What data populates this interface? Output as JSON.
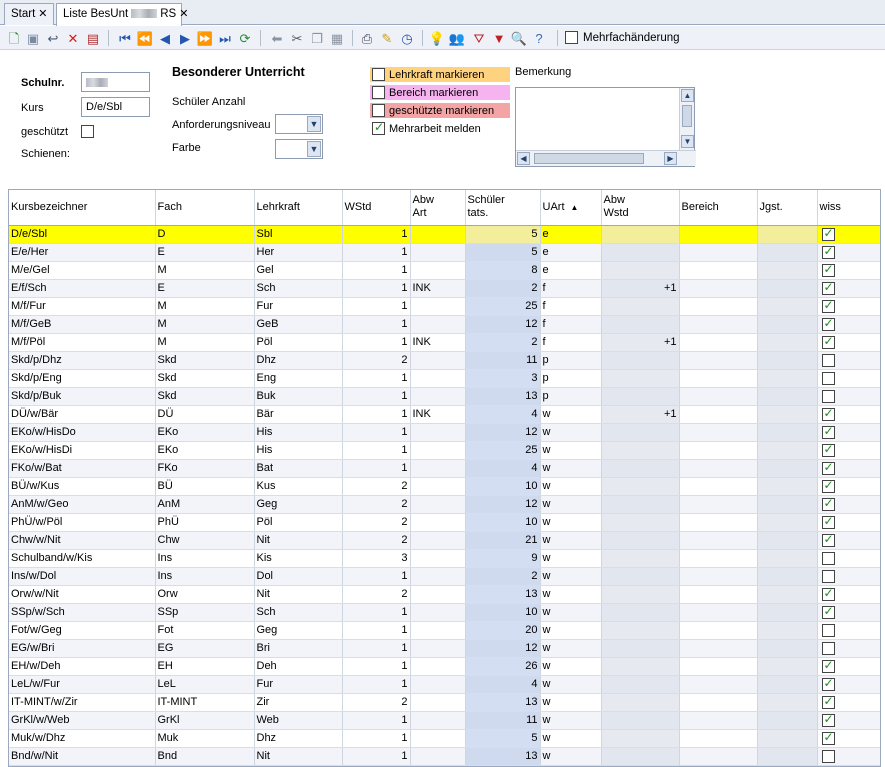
{
  "tabs": [
    {
      "label": "Start",
      "close": "✕"
    },
    {
      "label_before": "Liste BesUnt",
      "label_after": "RS",
      "close": "✕"
    }
  ],
  "toolbar": {
    "icons": [
      "new-icon",
      "save-icon",
      "undo-icon",
      "delete-icon",
      "properties-icon",
      "first-icon",
      "prev-page-icon",
      "prev-icon",
      "next-icon",
      "next-page-icon",
      "last-icon",
      "refresh-icon",
      "back-arrow-icon",
      "cut-icon",
      "copy-icon",
      "paste-icon",
      "print-icon",
      "broom-icon",
      "clock-icon",
      "bulb-icon",
      "users-icon",
      "filter-delete-icon",
      "filter-icon",
      "user-search-icon",
      "help-icon"
    ],
    "mehrfach_label": "Mehrfachänderung",
    "mehrfach_checked": false
  },
  "form": {
    "schulnr_label": "Schulnr.",
    "kurs_label": "Kurs",
    "kurs_value": "D/e/Sbl",
    "geschuetzt_label": "geschützt",
    "schienen_label": "Schienen:",
    "title": "Besonderer Unterricht",
    "schueler_anzahl_label": "Schüler Anzahl",
    "anforderung_label": "Anforderungsniveau",
    "farbe_label": "Farbe",
    "highlight_teacher": "Lehrkraft markieren",
    "highlight_area": "Bereich markieren",
    "highlight_protected": "geschützte markieren",
    "mehrarbeit_label": "Mehrarbeit melden",
    "mehrarbeit_checked": true,
    "bemerkung_label": "Bemerkung",
    "colors": {
      "teacher": "#ffd27f",
      "area": "#f7b3f0",
      "protected": "#f4a4a4"
    }
  },
  "grid": {
    "headers": [
      "Kursbezeichner",
      "Fach",
      "Lehrkraft",
      "WStd",
      "Abw\nArt",
      "Schüler\ntats.",
      "UArt",
      "Abw\nWstd",
      "Bereich",
      "Jgst.",
      "wiss"
    ],
    "rows": [
      [
        "D/e/Sbl",
        "D",
        "Sbl",
        "1",
        "",
        "5",
        "e",
        "",
        "",
        "",
        true
      ],
      [
        "E/e/Her",
        "E",
        "Her",
        "1",
        "",
        "5",
        "e",
        "",
        "",
        "",
        true
      ],
      [
        "M/e/Gel",
        "M",
        "Gel",
        "1",
        "",
        "8",
        "e",
        "",
        "",
        "",
        true
      ],
      [
        "E/f/Sch",
        "E",
        "Sch",
        "1",
        "INK",
        "2",
        "f",
        "+1",
        "",
        "",
        true
      ],
      [
        "M/f/Fur",
        "M",
        "Fur",
        "1",
        "",
        "25",
        "f",
        "",
        "",
        "",
        true
      ],
      [
        "M/f/GeB",
        "M",
        "GeB",
        "1",
        "",
        "12",
        "f",
        "",
        "",
        "",
        true
      ],
      [
        "M/f/Pöl",
        "M",
        "Pöl",
        "1",
        "INK",
        "2",
        "f",
        "+1",
        "",
        "",
        true
      ],
      [
        "Skd/p/Dhz",
        "Skd",
        "Dhz",
        "2",
        "",
        "11",
        "p",
        "",
        "",
        "",
        false
      ],
      [
        "Skd/p/Eng",
        "Skd",
        "Eng",
        "1",
        "",
        "3",
        "p",
        "",
        "",
        "",
        false
      ],
      [
        "Skd/p/Buk",
        "Skd",
        "Buk",
        "1",
        "",
        "13",
        "p",
        "",
        "",
        "",
        false
      ],
      [
        "DÜ/w/Bär",
        "DÜ",
        "Bär",
        "1",
        "INK",
        "4",
        "w",
        "+1",
        "",
        "",
        true
      ],
      [
        "EKo/w/HisDo",
        "EKo",
        "His",
        "1",
        "",
        "12",
        "w",
        "",
        "",
        "",
        true
      ],
      [
        "EKo/w/HisDi",
        "EKo",
        "His",
        "1",
        "",
        "25",
        "w",
        "",
        "",
        "",
        true
      ],
      [
        "FKo/w/Bat",
        "FKo",
        "Bat",
        "1",
        "",
        "4",
        "w",
        "",
        "",
        "",
        true
      ],
      [
        "BÜ/w/Kus",
        "BÜ",
        "Kus",
        "2",
        "",
        "10",
        "w",
        "",
        "",
        "",
        true
      ],
      [
        "AnM/w/Geo",
        "AnM",
        "Geg",
        "2",
        "",
        "12",
        "w",
        "",
        "",
        "",
        true
      ],
      [
        "PhÜ/w/Pöl",
        "PhÜ",
        "Pöl",
        "2",
        "",
        "10",
        "w",
        "",
        "",
        "",
        true
      ],
      [
        "Chw/w/Nit",
        "Chw",
        "Nit",
        "2",
        "",
        "21",
        "w",
        "",
        "",
        "",
        true
      ],
      [
        "Schulband/w/Kis",
        "Ins",
        "Kis",
        "3",
        "",
        "9",
        "w",
        "",
        "",
        "",
        false
      ],
      [
        "Ins/w/Dol",
        "Ins",
        "Dol",
        "1",
        "",
        "2",
        "w",
        "",
        "",
        "",
        false
      ],
      [
        "Orw/w/Nit",
        "Orw",
        "Nit",
        "2",
        "",
        "13",
        "w",
        "",
        "",
        "",
        true
      ],
      [
        "SSp/w/Sch",
        "SSp",
        "Sch",
        "1",
        "",
        "10",
        "w",
        "",
        "",
        "",
        true
      ],
      [
        "Fot/w/Geg",
        "Fot",
        "Geg",
        "1",
        "",
        "20",
        "w",
        "",
        "",
        "",
        false
      ],
      [
        "EG/w/Bri",
        "EG",
        "Bri",
        "1",
        "",
        "12",
        "w",
        "",
        "",
        "",
        false
      ],
      [
        "EH/w/Deh",
        "EH",
        "Deh",
        "1",
        "",
        "26",
        "w",
        "",
        "",
        "",
        true
      ],
      [
        "LeL/w/Fur",
        "LeL",
        "Fur",
        "1",
        "",
        "4",
        "w",
        "",
        "",
        "",
        true
      ],
      [
        "IT-MINT/w/Zir",
        "IT-MINT",
        "Zir",
        "2",
        "",
        "13",
        "w",
        "",
        "",
        "",
        true
      ],
      [
        "GrKl/w/Web",
        "GrKl",
        "Web",
        "1",
        "",
        "11",
        "w",
        "",
        "",
        "",
        true
      ],
      [
        "Muk/w/Dhz",
        "Muk",
        "Dhz",
        "1",
        "",
        "5",
        "w",
        "",
        "",
        "",
        true
      ],
      [
        "Bnd/w/Nit",
        "Bnd",
        "Nit",
        "1",
        "",
        "13",
        "w",
        "",
        "",
        "",
        false
      ]
    ]
  }
}
